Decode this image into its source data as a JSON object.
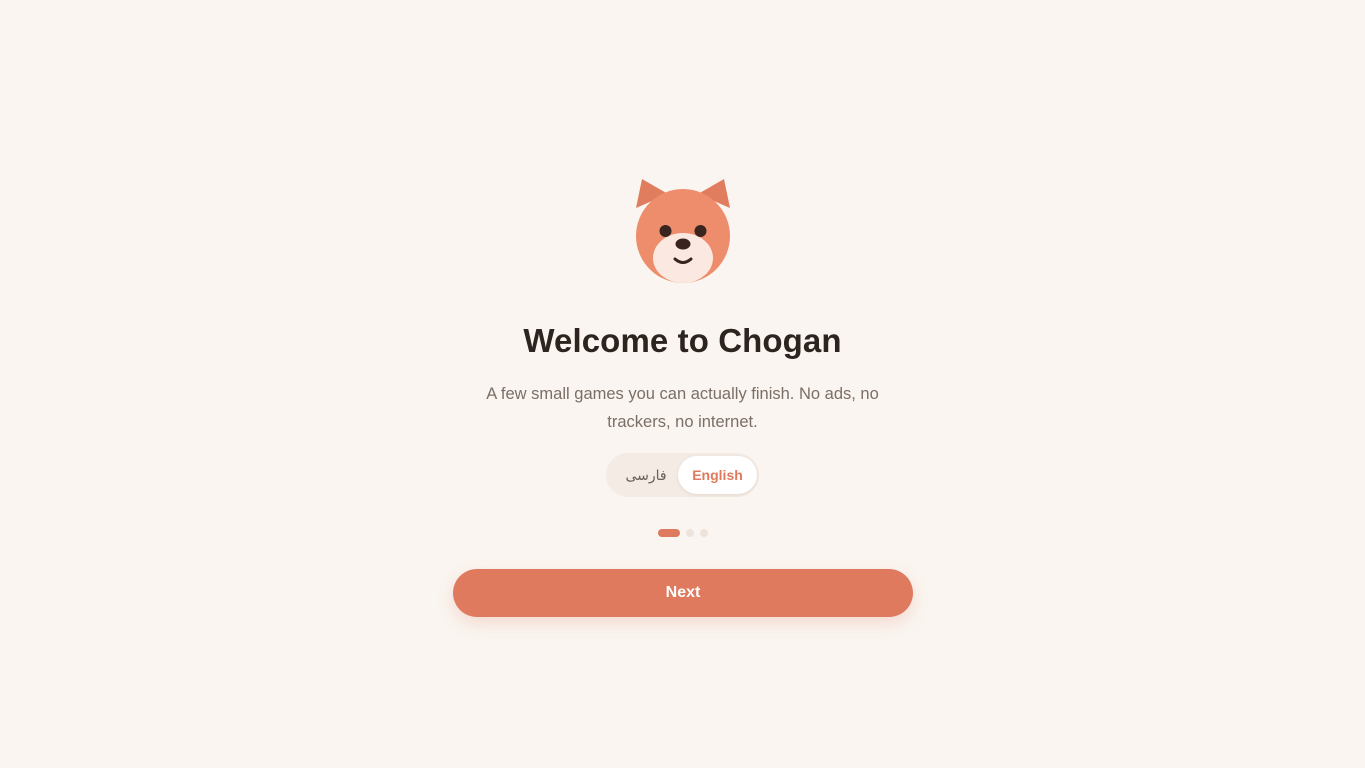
{
  "onboarding": {
    "mascot_icon": "bear-mascot-icon",
    "title": "Welcome to Chogan",
    "subtitle": "A few small games you can actually finish. No ads, no trackers, no internet.",
    "language_toggle": {
      "options": [
        {
          "label": "فارسی",
          "selected": false
        },
        {
          "label": "English",
          "selected": true
        }
      ]
    },
    "pager": {
      "total_steps": 3,
      "current_step": 1
    },
    "next_label": "Next"
  },
  "colors": {
    "background": "#faf5f0",
    "accent": "#df7a5e",
    "title_text": "#2d2420",
    "body_text": "#7b6e66",
    "mascot_fur": "#ee8d6c",
    "mascot_ears": "#e07d5e",
    "mascot_muzzle": "#fbe9e1",
    "mascot_features": "#3a2420"
  }
}
